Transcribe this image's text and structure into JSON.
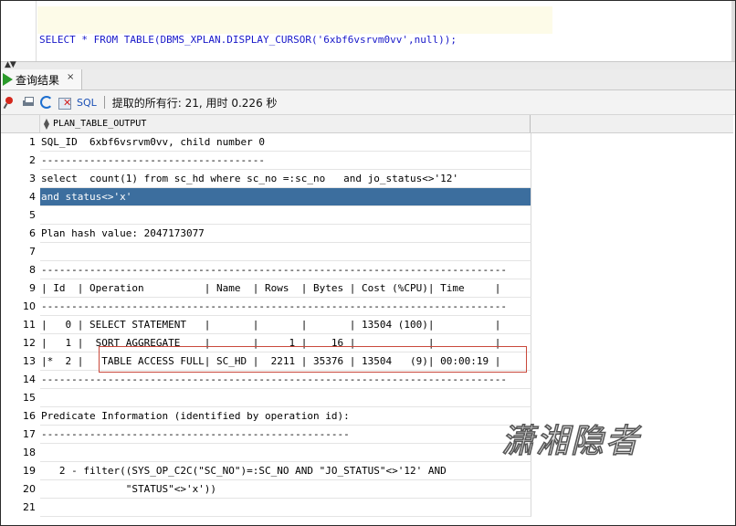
{
  "editor": {
    "sql": "SELECT * FROM TABLE(DBMS_XPLAN.DISPLAY_CURSOR('6xbf6vsrvm0vv',null));"
  },
  "result_tab": {
    "label": "查询结果",
    "close": "×"
  },
  "toolbar": {
    "sql_label": "SQL",
    "status": "提取的所有行: 21, 用时 0.226 秒"
  },
  "grid": {
    "column_header": "PLAN_TABLE_OUTPUT",
    "rows": [
      {
        "n": "1",
        "text": "SQL_ID  6xbf6vsrvm0vv, child number 0"
      },
      {
        "n": "2",
        "text": "-------------------------------------"
      },
      {
        "n": "3",
        "text": "select  count(1) from sc_hd where sc_no =:sc_no   and jo_status<>'12'"
      },
      {
        "n": "4",
        "text": "and status<>'x'"
      },
      {
        "n": "5",
        "text": ""
      },
      {
        "n": "6",
        "text": "Plan hash value: 2047173077"
      },
      {
        "n": "7",
        "text": ""
      },
      {
        "n": "8",
        "text": "-----------------------------------------------------------------------------"
      },
      {
        "n": "9",
        "text": "| Id  | Operation          | Name  | Rows  | Bytes | Cost (%CPU)| Time     |"
      },
      {
        "n": "10",
        "text": "-----------------------------------------------------------------------------"
      },
      {
        "n": "11",
        "text": "|   0 | SELECT STATEMENT   |       |       |       | 13504 (100)|          |"
      },
      {
        "n": "12",
        "text": "|   1 |  SORT AGGREGATE    |       |     1 |    16 |            |          |"
      },
      {
        "n": "13",
        "text": "|*  2 |   TABLE ACCESS FULL| SC_HD |  2211 | 35376 | 13504   (9)| 00:00:19 |"
      },
      {
        "n": "14",
        "text": "-----------------------------------------------------------------------------"
      },
      {
        "n": "15",
        "text": ""
      },
      {
        "n": "16",
        "text": "Predicate Information (identified by operation id):"
      },
      {
        "n": "17",
        "text": "---------------------------------------------------"
      },
      {
        "n": "18",
        "text": ""
      },
      {
        "n": "19",
        "text": "   2 - filter((SYS_OP_C2C(\"SC_NO\")=:SC_NO AND \"JO_STATUS\"<>'12' AND"
      },
      {
        "n": "20",
        "text": "              \"STATUS\"<>'x'))"
      },
      {
        "n": "21",
        "text": ""
      }
    ],
    "selected_row": "4"
  },
  "watermark": "潇湘隐者"
}
